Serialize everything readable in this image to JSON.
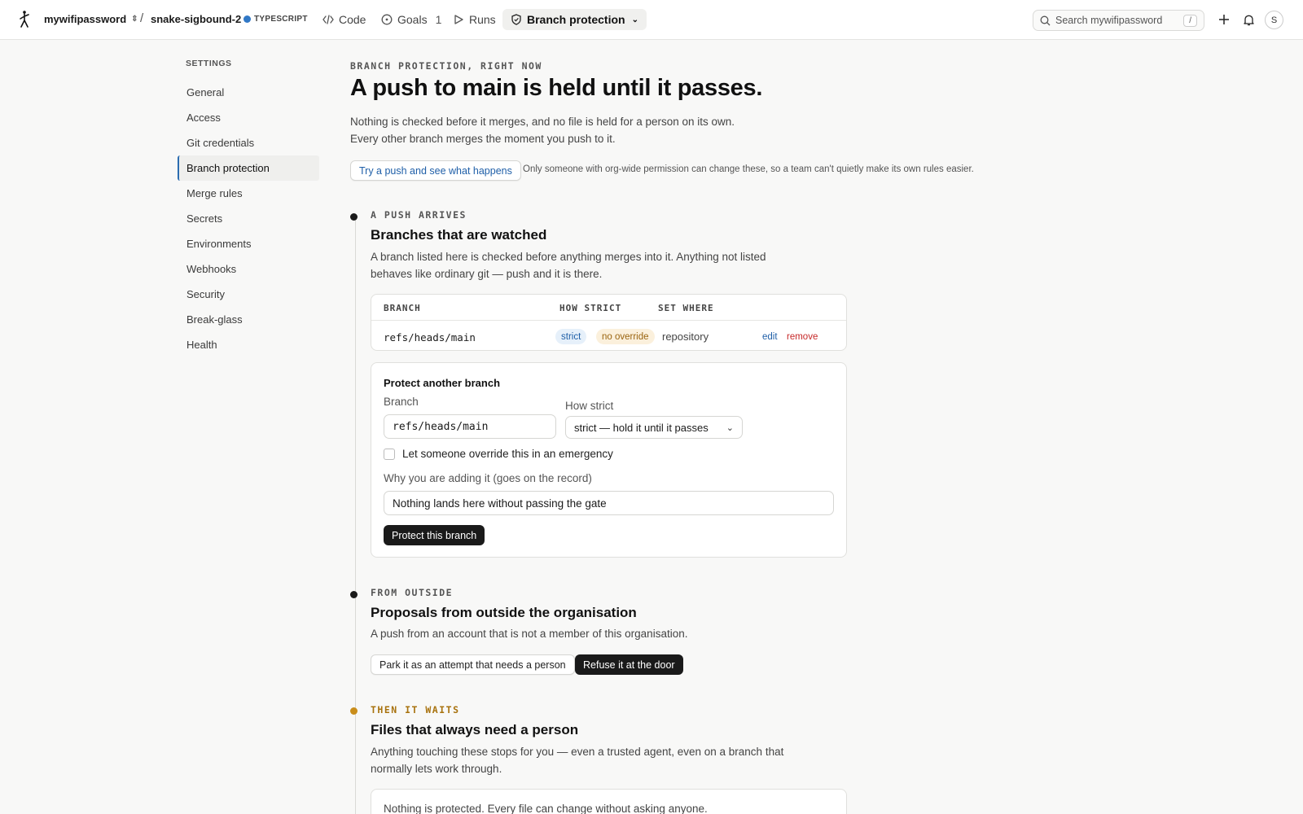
{
  "topbar": {
    "org": "mywifipassword",
    "separator": "/",
    "repo": "snake-sigbound-2",
    "language": "TYPESCRIPT",
    "language_color": "#3178c6",
    "nav": [
      {
        "label": "Code",
        "icon": "code-icon"
      },
      {
        "label": "Goals",
        "icon": "goal-icon",
        "count": "1"
      },
      {
        "label": "Runs",
        "icon": "play-icon"
      },
      {
        "label": "Branch protection",
        "icon": "shield-icon",
        "active": true
      }
    ],
    "search_placeholder": "Search mywifipassword",
    "search_shortcut": "/",
    "avatar_initial": "S"
  },
  "sidebar": {
    "heading": "SETTINGS",
    "items": [
      {
        "label": "General"
      },
      {
        "label": "Access"
      },
      {
        "label": "Git credentials"
      },
      {
        "label": "Branch protection",
        "active": true
      },
      {
        "label": "Merge rules"
      },
      {
        "label": "Secrets"
      },
      {
        "label": "Environments"
      },
      {
        "label": "Webhooks"
      },
      {
        "label": "Security"
      },
      {
        "label": "Break-glass"
      },
      {
        "label": "Health"
      }
    ]
  },
  "header": {
    "eyebrow": "BRANCH PROTECTION, RIGHT NOW",
    "title": "A push to main is held until it passes.",
    "lead_line1": "Nothing is checked before it merges, and no file is held for a person on its own.",
    "lead_line2": "Every other branch merges the moment you push to it.",
    "try_button": "Try a push and see what happens",
    "note": "Only someone with org-wide permission can change these, so a team can't quietly make its own rules easier."
  },
  "push_section": {
    "eyebrow": "A PUSH ARRIVES",
    "title": "Branches that are watched",
    "desc_line1": "A branch listed here is checked before anything merges into it. Anything not listed",
    "desc_line2": "behaves like ordinary git — push and it is there.",
    "table": {
      "headers": [
        "BRANCH",
        "HOW STRICT",
        "SET WHERE"
      ],
      "row": {
        "branch": "refs/heads/main",
        "strictness": "strict",
        "override": "no override",
        "set_where": "repository",
        "edit": "edit",
        "remove": "remove"
      }
    },
    "form": {
      "title": "Protect another branch",
      "branch_label": "Branch",
      "branch_value": "refs/heads/main",
      "strict_label": "How strict",
      "strict_value": "strict — hold it until it passes",
      "override_label": "Let someone override this in an emergency",
      "override_checked": false,
      "reason_label": "Why you are adding it (goes on the record)",
      "reason_value": "Nothing lands here without passing the gate",
      "submit": "Protect this branch"
    }
  },
  "outside_section": {
    "eyebrow": "FROM OUTSIDE",
    "title": "Proposals from outside the organisation",
    "desc": "A push from an account that is not a member of this organisation.",
    "option_park": "Park it as an attempt that needs a person",
    "option_refuse": "Refuse it at the door",
    "selected": "Refuse it at the door"
  },
  "waits_section": {
    "eyebrow": "THEN IT WAITS",
    "eyebrow_color": "#a8720e",
    "title": "Files that always need a person",
    "desc_line1": "Anything touching these stops for you — even a trusted agent, even on a branch that",
    "desc_line2": "normally lets work through.",
    "empty_text": "Nothing is protected. Every file can change without asking anyone."
  },
  "colors": {
    "link_blue": "#1f5fa8",
    "remove_red": "#c62828",
    "amber_dot": "#c98d1a"
  }
}
